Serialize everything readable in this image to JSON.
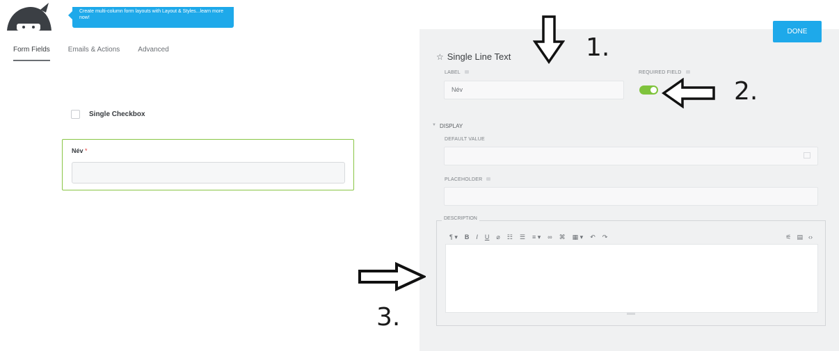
{
  "promo": {
    "text": "Create multi-column form layouts with Layout & Styles...learn more now!"
  },
  "tabs": [
    {
      "label": "Form Fields"
    },
    {
      "label": "Emails & Actions"
    },
    {
      "label": "Advanced"
    }
  ],
  "form": {
    "checkbox_label": "Single Checkbox",
    "field_label": "Név",
    "required_marker": "*"
  },
  "drawer": {
    "done_label": "DONE",
    "title": "Single Line Text",
    "label_caption": "LABEL",
    "label_value": "Név",
    "required_caption": "REQUIRED FIELD",
    "required_on": true,
    "display_section": "DISPLAY",
    "default_value_caption": "DEFAULT VALUE",
    "placeholder_caption": "PLACEHOLDER",
    "description_caption": "DESCRIPTION"
  },
  "toolbar": {
    "items": [
      "paragraph-icon",
      "bold-icon",
      "italic-icon",
      "underline-icon",
      "eraser-icon",
      "ordered-list-icon",
      "unordered-list-icon",
      "align-icon",
      "link-icon",
      "unlink-icon",
      "table-icon",
      "undo-icon",
      "redo-icon",
      "media-icon",
      "code-view-icon",
      "html-icon"
    ]
  },
  "annotations": {
    "one": "1.",
    "two": "2.",
    "three": "3."
  },
  "colors": {
    "accent": "#1ea9ea",
    "valid_border": "#88c544",
    "toggle_on": "#7fc33c",
    "required_star": "#e23b3b"
  }
}
